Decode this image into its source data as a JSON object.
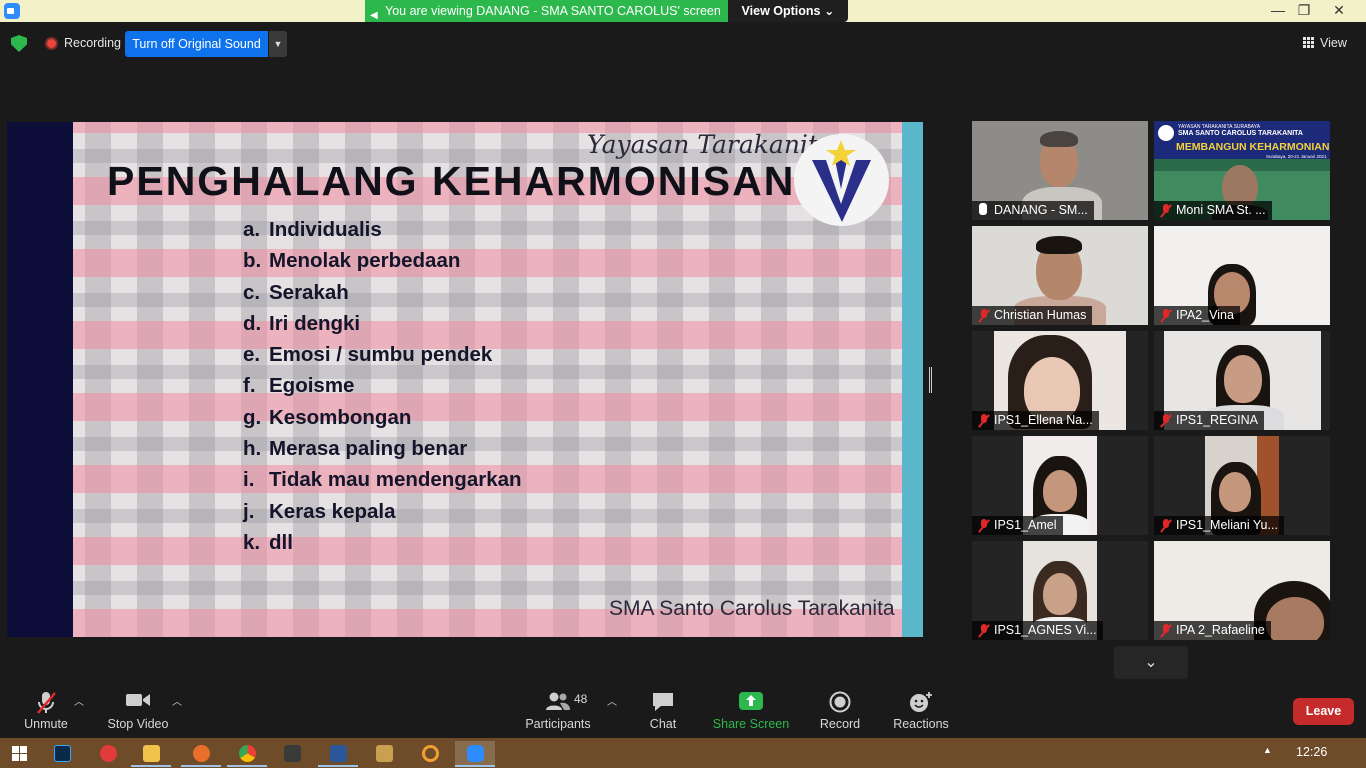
{
  "window": {
    "viewing_banner": "You are viewing DANANG - SMA SANTO CAROLUS' screen",
    "view_options": "View Options ⌄",
    "controls": {
      "minimize": "—",
      "maximize": "❐",
      "close": "✕"
    }
  },
  "top_toolbar": {
    "recording_label": "Recording",
    "original_sound_button": "Turn off Original Sound",
    "view_button": "View"
  },
  "slide": {
    "org_name": "Yayasan Tarakanita",
    "heading": "PENGHALANG KEHARMONISAN",
    "items": [
      {
        "letter": "a.",
        "text": "Individualis"
      },
      {
        "letter": "b.",
        "text": "Menolak perbedaan"
      },
      {
        "letter": "c.",
        "text": "Serakah"
      },
      {
        "letter": "d.",
        "text": "Iri dengki"
      },
      {
        "letter": "e.",
        "text": "Emosi / sumbu pendek"
      },
      {
        "letter": "f.",
        "text": "Egoisme"
      },
      {
        "letter": "g.",
        "text": "Kesombongan"
      },
      {
        "letter": "h.",
        "text": "Merasa paling benar"
      },
      {
        "letter": "i.",
        "text": "Tidak mau mendengarkan"
      },
      {
        "letter": "j.",
        "text": "Keras kepala"
      },
      {
        "letter": "k.",
        "text": "dll"
      }
    ],
    "footer": "SMA Santo Carolus Tarakanita"
  },
  "gallery": {
    "participants": [
      {
        "name": "DANANG - SM...",
        "muted": false,
        "active": true
      },
      {
        "name": "Moni SMA St. ...",
        "muted": true,
        "active": false
      },
      {
        "name": "Christian Humas",
        "muted": true,
        "active": false
      },
      {
        "name": "IPA2_Vina",
        "muted": true,
        "active": false
      },
      {
        "name": "IPS1_Ellena Na...",
        "muted": true,
        "active": false
      },
      {
        "name": "IPS1_REGINA",
        "muted": true,
        "active": false
      },
      {
        "name": "IPS1_Amel",
        "muted": true,
        "active": false
      },
      {
        "name": "IPS1_Meliani Yu...",
        "muted": true,
        "active": false
      },
      {
        "name": "IPS1_AGNES Vi...",
        "muted": true,
        "active": false
      },
      {
        "name": "IPA 2_Rafaeline",
        "muted": true,
        "active": false
      }
    ],
    "moni_banner": {
      "line1": "YAYASAN TARAKANITA SURABAYA",
      "line2": "SMA SANTO CAROLUS TARAKANITA",
      "title": "MEMBANGUN KEHARMONIAN",
      "subtitle": "Surabaya, 20-21 Januari 2021"
    }
  },
  "bottom_toolbar": {
    "unmute": "Unmute",
    "stop_video": "Stop Video",
    "participants_count": "48",
    "participants": "Participants",
    "chat": "Chat",
    "share_screen": "Share Screen",
    "record": "Record",
    "reactions": "Reactions",
    "leave": "Leave"
  },
  "taskbar": {
    "clock": "12:26"
  },
  "colors": {
    "zoom_blue": "#0e72ed",
    "share_green": "#2db84d",
    "leave_red": "#c62b2b",
    "active_speaker": "#d8e64a"
  }
}
